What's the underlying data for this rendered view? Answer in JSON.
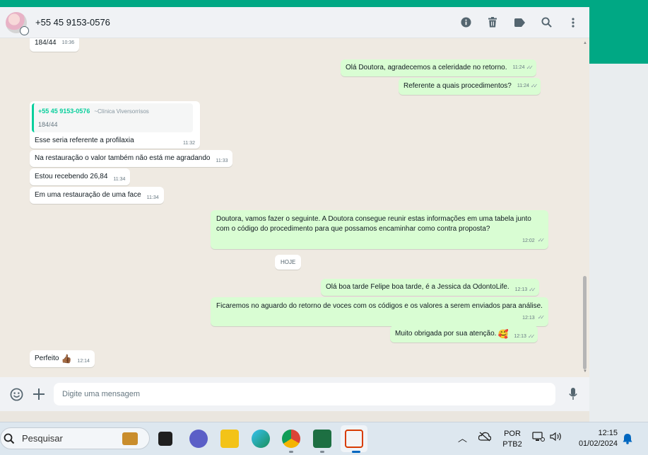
{
  "header": {
    "contact_name": "+55 45 9153-0576",
    "icons": [
      "info-icon",
      "delete-icon",
      "label-icon",
      "search-icon",
      "menu-icon"
    ]
  },
  "messages": [
    {
      "dir": "in",
      "text": "184/44",
      "time": "10:36"
    },
    {
      "dir": "out",
      "text": "Olá Doutora, agradecemos a celeridade no retorno.",
      "time": "11:24"
    },
    {
      "dir": "out",
      "text": "Referente a quais procedimentos?",
      "time": "11:24"
    },
    {
      "dir": "in",
      "quote_name": "+55 45 9153-0576",
      "quote_pushname": "~Clínica Viversorrisos",
      "quote_text": "184/44",
      "text": "Esse seria referente a profilaxia",
      "time": "11:32"
    },
    {
      "dir": "in",
      "text": "Na restauração o valor também não está me agradando",
      "time": "11:33"
    },
    {
      "dir": "in",
      "text": "Estou recebendo 26,84",
      "time": "11:34"
    },
    {
      "dir": "in",
      "text": "Em uma restauração de uma face",
      "time": "11:34"
    },
    {
      "dir": "out",
      "text": "Doutora, vamos fazer o seguinte. A Doutora consegue reunir estas informações em uma tabela junto com o código do procedimento para que possamos encaminhar como contra proposta?",
      "time": "12:02"
    },
    {
      "dir": "out",
      "text": "Olá boa tarde Felipe boa tarde, é a Jessica da OdontoLife.",
      "time": "12:13"
    },
    {
      "dir": "out",
      "text": "Ficaremos no aguardo do retorno de voces com os códigos e os valores a serem enviados para análise.",
      "time": "12:13"
    },
    {
      "dir": "out",
      "text": "Muito obrigada por sua atenção.",
      "emoji": "🥰",
      "time": "12:13"
    },
    {
      "dir": "in",
      "text": "Perfeito",
      "emoji": "👍🏾",
      "time": "12:14"
    }
  ],
  "date_divider": "HOJE",
  "composer": {
    "placeholder": "Digite uma mensagem"
  },
  "taskbar": {
    "search_label": "Pesquisar",
    "lang_line1": "POR",
    "lang_line2": "PTB2",
    "clock_time": "12:15",
    "clock_date": "01/02/2024"
  },
  "colors": {
    "accent": "#00a884",
    "outgoing_bubble": "#d9fdd3",
    "incoming_bubble": "#ffffff",
    "chat_background": "#efeae2"
  }
}
